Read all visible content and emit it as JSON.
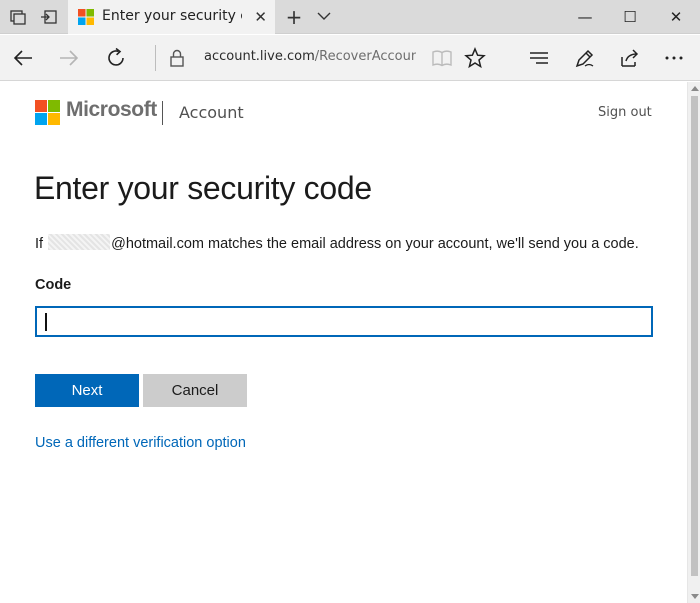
{
  "browser": {
    "tab_title": "Enter your security code",
    "tab_close": "✕",
    "new_tab": "+",
    "url_domain": "account.live.com",
    "url_path": "/RecoverAccount?",
    "window_buttons": {
      "minimize": "—",
      "maximize": "☐",
      "close": "✕"
    }
  },
  "header": {
    "brand": "Microsoft",
    "subtitle": "Account",
    "sign_out": "Sign out",
    "logo_colors": [
      "#f25022",
      "#7fba00",
      "#00a4ef",
      "#ffb900"
    ]
  },
  "main": {
    "heading": "Enter your security code",
    "message_prefix": "If",
    "message_suffix": "@hotmail.com matches the email address on your account, we'll send you a code.",
    "code_label": "Code",
    "code_value": "",
    "next_button": "Next",
    "cancel_button": "Cancel",
    "alt_link": "Use a different verification option"
  },
  "colors": {
    "accent": "#0067b8",
    "cancel_bg": "#cccccc"
  }
}
